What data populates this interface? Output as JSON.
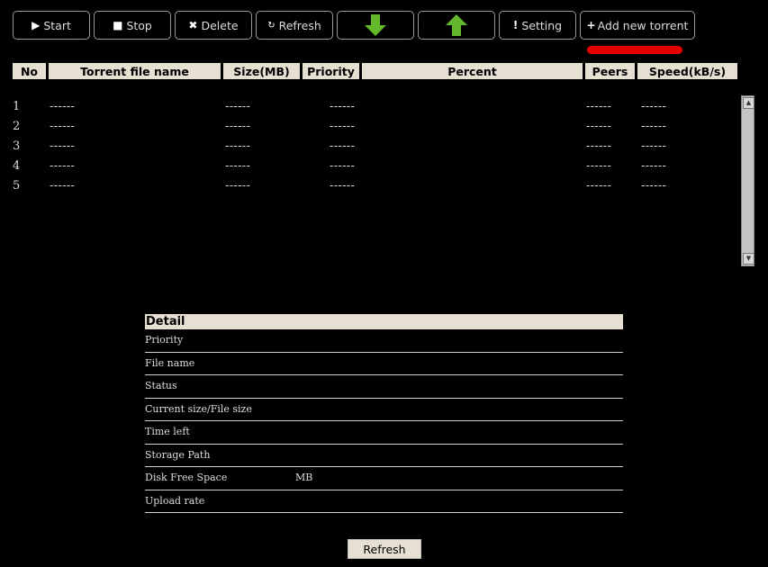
{
  "toolbar": {
    "start": "Start",
    "stop": "Stop",
    "delete": "Delete",
    "refresh": "Refresh",
    "setting": "Setting",
    "add": "Add new torrent"
  },
  "icons": {
    "start": "play-icon",
    "stop": "stop-square-icon",
    "delete": "x-icon",
    "refresh": "refresh-icon",
    "down": "green-arrow-down-icon",
    "up": "green-arrow-up-icon",
    "setting": "exclamation-icon",
    "add": "plus-icon"
  },
  "colors": {
    "arrow_green": "#63b82b",
    "highlight_red": "#e30000",
    "header_bg": "#e6e0d2"
  },
  "table": {
    "columns": [
      "No",
      "Torrent file name",
      "Size(MB)",
      "Priority",
      "Percent",
      "Peers",
      "Speed(kB/s)"
    ],
    "rows": [
      {
        "no": "1",
        "name": "------",
        "size": "------",
        "priority": "------",
        "peers": "------",
        "speed": "------"
      },
      {
        "no": "2",
        "name": "------",
        "size": "------",
        "priority": "------",
        "peers": "------",
        "speed": "------"
      },
      {
        "no": "3",
        "name": "------",
        "size": "------",
        "priority": "------",
        "peers": "------",
        "speed": "------"
      },
      {
        "no": "4",
        "name": "------",
        "size": "------",
        "priority": "------",
        "peers": "------",
        "speed": "------"
      },
      {
        "no": "5",
        "name": "------",
        "size": "------",
        "priority": "------",
        "peers": "------",
        "speed": "------"
      }
    ]
  },
  "detail": {
    "title": "Detail",
    "rows": [
      {
        "label": "Priority",
        "value": ""
      },
      {
        "label": "File name",
        "value": ""
      },
      {
        "label": "Status",
        "value": ""
      },
      {
        "label": "Current size/File size",
        "value": ""
      },
      {
        "label": "Time left",
        "value": ""
      },
      {
        "label": "Storage Path",
        "value": ""
      },
      {
        "label": "Disk Free Space",
        "value": "MB"
      },
      {
        "label": "Upload rate",
        "value": ""
      }
    ]
  },
  "bottom": {
    "refresh": "Refresh"
  }
}
